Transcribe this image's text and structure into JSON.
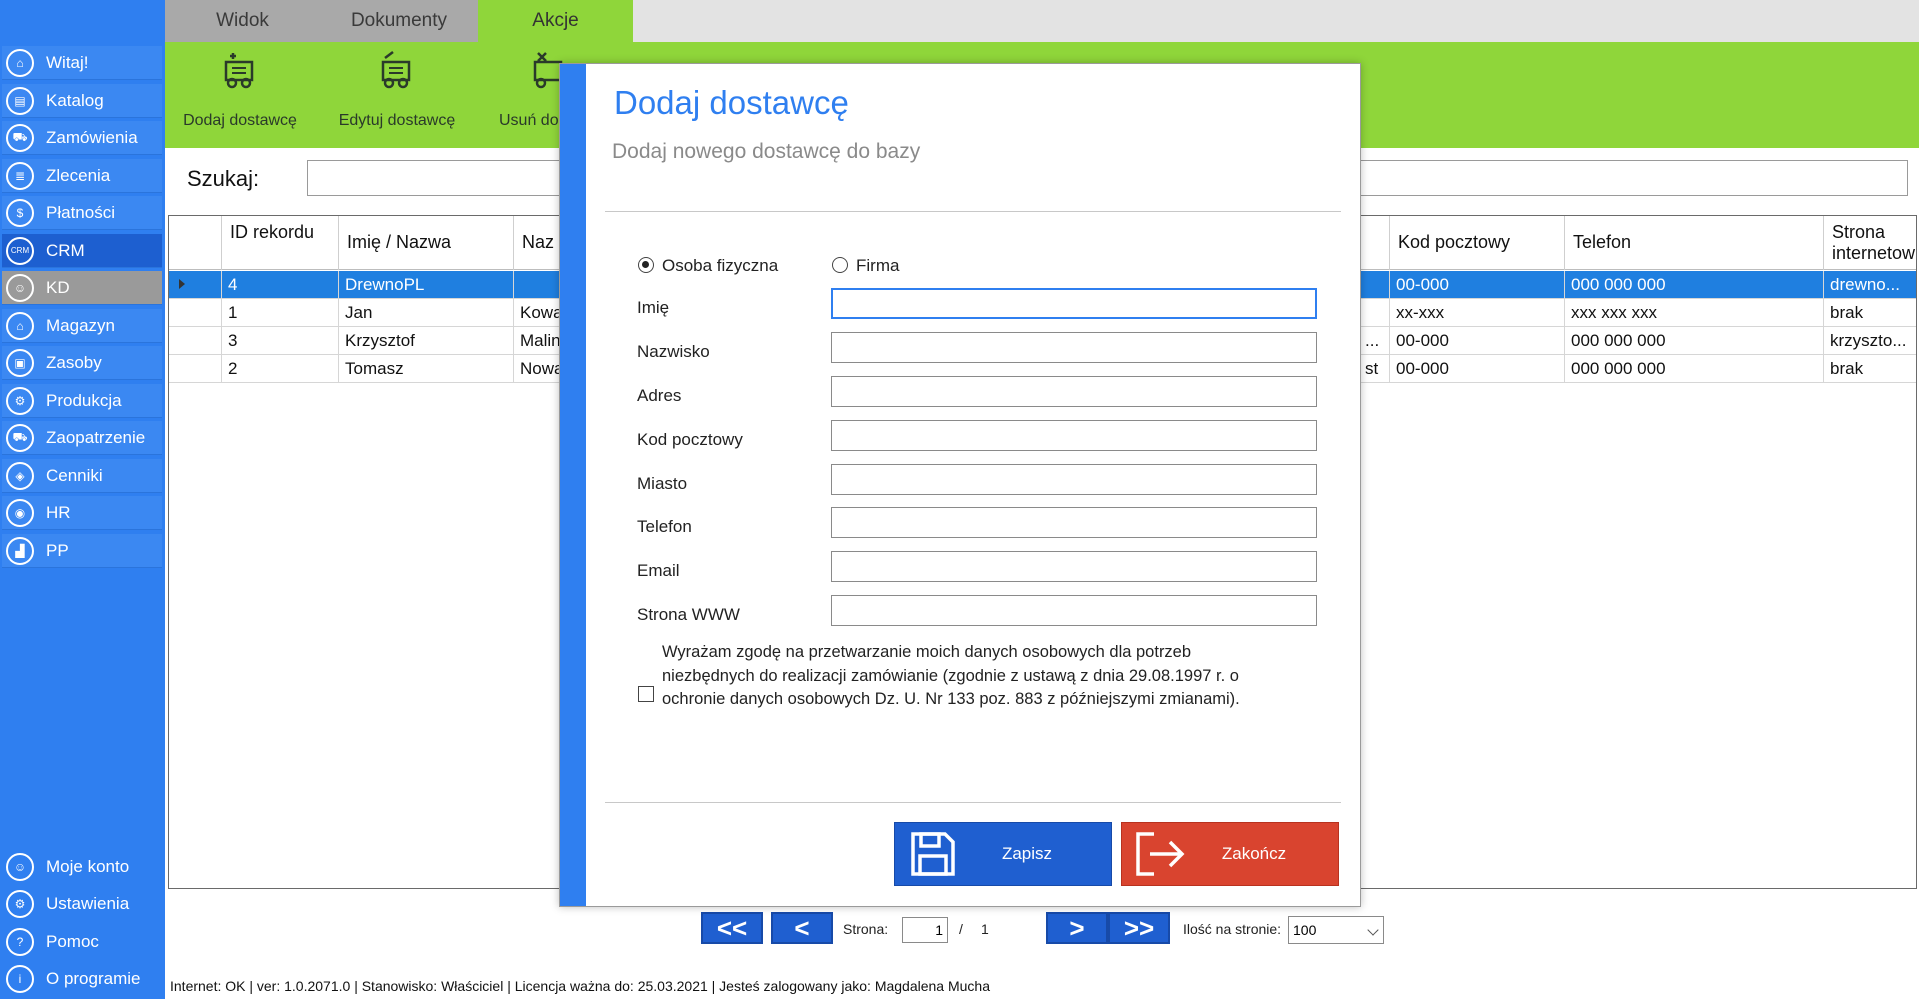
{
  "tabs": [
    "Widok",
    "Dokumenty",
    "Akcje"
  ],
  "ribbon": {
    "buttons": [
      {
        "label": "Dodaj dostawcę",
        "icon": "supplier-add-icon"
      },
      {
        "label": "Edytuj dostawcę",
        "icon": "supplier-edit-icon"
      },
      {
        "label": "Usuń do",
        "icon": "supplier-delete-icon"
      }
    ]
  },
  "sidebar": {
    "items": [
      {
        "label": "Witaj!",
        "icon": "home-icon"
      },
      {
        "label": "Katalog",
        "icon": "book-icon"
      },
      {
        "label": "Zamówienia",
        "icon": "cart-icon"
      },
      {
        "label": "Zlecenia",
        "icon": "list-icon"
      },
      {
        "label": "Płatności",
        "icon": "dollar-icon"
      },
      {
        "label": "CRM",
        "icon": "crm-icon"
      },
      {
        "label": "KD",
        "icon": "person-icon"
      },
      {
        "label": "Magazyn",
        "icon": "warehouse-icon"
      },
      {
        "label": "Zasoby",
        "icon": "box-icon"
      },
      {
        "label": "Produkcja",
        "icon": "gear-icon"
      },
      {
        "label": "Zaopatrzenie",
        "icon": "truck-icon"
      },
      {
        "label": "Cenniki",
        "icon": "tag-icon"
      },
      {
        "label": "HR",
        "icon": "hr-icon"
      },
      {
        "label": "PP",
        "icon": "factory-icon"
      }
    ],
    "bottom_items": [
      {
        "label": "Moje konto",
        "icon": "user-icon"
      },
      {
        "label": "Ustawienia",
        "icon": "settings-icon"
      },
      {
        "label": "Pomoc",
        "icon": "help-icon"
      },
      {
        "label": "O programie",
        "icon": "info-icon"
      }
    ],
    "active": "KD"
  },
  "search": {
    "label": "Szukaj:",
    "value": ""
  },
  "grid": {
    "columns": [
      "ID rekordu",
      "Imię / Nazwa",
      "Naz",
      "Kod pocztowy",
      "Telefon",
      "Strona internetow"
    ],
    "rows": [
      {
        "id": "4",
        "name": "DrewnoPL",
        "naz": "",
        "extra": "",
        "kod": "00-000",
        "tel": "000 000 000",
        "www": "drewno..."
      },
      {
        "id": "1",
        "name": "Jan",
        "naz": "Kowa",
        "extra": "",
        "kod": "xx-xxx",
        "tel": "xxx xxx xxx",
        "www": "brak"
      },
      {
        "id": "3",
        "name": "Krzysztof",
        "naz": "Malin",
        "extra": "...",
        "kod": "00-000",
        "tel": "000 000 000",
        "www": "krzyszto..."
      },
      {
        "id": "2",
        "name": "Tomasz",
        "naz": "Nowa",
        "extra": "st",
        "kod": "00-000",
        "tel": "000 000 000",
        "www": "brak"
      }
    ]
  },
  "pager": {
    "first": "<<",
    "prev": "<",
    "next": ">",
    "last": ">>",
    "page_label": "Strona:",
    "page": "1",
    "separator": "/",
    "total": "1",
    "per_page_label": "Ilość na stronie:",
    "per_page": "100"
  },
  "status": "Internet: OK  |   ver: 1.0.2071.0   |   Stanowisko: Właściciel    |   Licencja ważna do: 25.03.2021   |   Jesteś zalogowany jako: Magdalena Mucha",
  "modal": {
    "title": "Dodaj dostawcę",
    "subtitle": "Dodaj nowego dostawcę do bazy",
    "type_person": "Osoba fizyczna",
    "type_company": "Firma",
    "selected_type": "Osoba fizyczna",
    "fields": [
      {
        "label": "Imię",
        "value": ""
      },
      {
        "label": "Nazwisko",
        "value": ""
      },
      {
        "label": "Adres",
        "value": ""
      },
      {
        "label": "Kod pocztowy",
        "value": ""
      },
      {
        "label": "Miasto",
        "value": ""
      },
      {
        "label": "Telefon",
        "value": ""
      },
      {
        "label": "Email",
        "value": ""
      },
      {
        "label": "Strona WWW",
        "value": ""
      }
    ],
    "consent": "Wyrażam zgodę na przetwarzanie moich danych osobowych dla potrzeb niezbędnych do realizacji zamówianie (zgodnie z ustawą z dnia 29.08.1997 r. o ochronie danych osobowych Dz. U. Nr 133 poz. 883 z późniejszymi zmianami).",
    "consent_checked": false,
    "save_label": "Zapisz",
    "exit_label": "Zakończ"
  },
  "colors": {
    "sidebar": "#2f7ff0",
    "ribbon": "#8fd63a",
    "selected_row": "#1f7fe0",
    "save_button": "#1f5fd0",
    "exit_button": "#d9442f"
  }
}
